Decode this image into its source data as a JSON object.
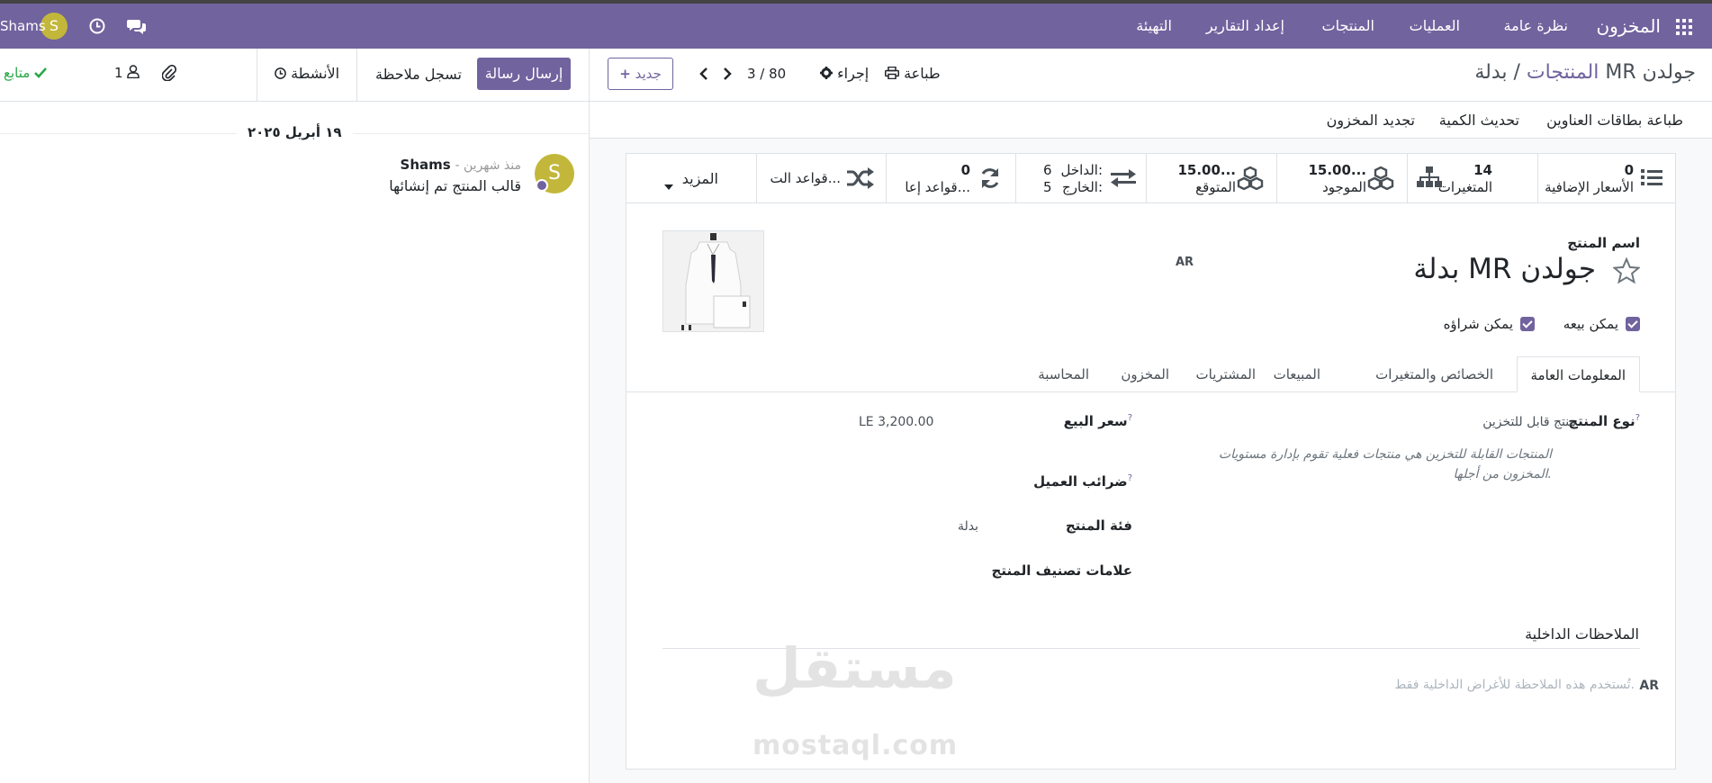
{
  "navbar": {
    "brand": "المخزون",
    "menu": [
      "نظرة عامة",
      "العمليات",
      "المنتجات",
      "إعداد التقارير",
      "التهيئة"
    ],
    "user_name": "Shams",
    "user_initial": "S"
  },
  "breadcrumb": {
    "parent": "المنتجات",
    "separator": "/",
    "current": "بدلة MR جولدن"
  },
  "toolbar": {
    "print": "طباعة",
    "action": "إجراء",
    "pager": "3 / 80",
    "new": "جديد"
  },
  "actions": [
    "طباعة بطاقات العناوين",
    "تحديث الكمية",
    "تجديد المخزون"
  ],
  "stats": {
    "extra_prices_value": "0",
    "extra_prices_label": "الأسعار الإضافية",
    "variants_value": "14",
    "variants_label": "المتغيرات",
    "on_hand_value": "15.00...",
    "on_hand_label": "الموجود",
    "forecast_value": "15.00...",
    "forecast_label": "المتوقع",
    "in_label": "الداخل:",
    "in_value": "6",
    "out_label": "الخارج:",
    "out_value": "5",
    "reorder_value": "0",
    "reorder_label": "قواعد إعا...",
    "routes_label": "قواعد الت...",
    "more_label": "المزيد"
  },
  "product": {
    "name_label": "اسم المنتج",
    "name": "بدلة MR جولدن",
    "lang": "AR",
    "can_be_sold": "يمكن بيعه",
    "can_be_purchased": "يمكن شراؤه"
  },
  "tabs": [
    "المعلومات العامة",
    "الخصائص والمتغيرات",
    "المبيعات",
    "المشتريات",
    "المخزون",
    "المحاسبة"
  ],
  "fields": {
    "product_type_label": "نوع المنتج",
    "product_type_value": "منتج قابل للتخزين",
    "product_type_help_1": "المنتجات القابلة للتخزين هي منتجات فعلية تقوم بإدارة مستويات",
    "product_type_help_2": "المخزون من أجلها.",
    "sale_price_label": "سعر البيع",
    "sale_price_value": "LE 3,200.00",
    "customer_taxes_label": "ضرائب العميل",
    "category_label": "فئة المنتج",
    "category_value": "بدلة",
    "tags_label": "علامات تصنيف المنتج",
    "tooltip_mark": "?"
  },
  "notes": {
    "title": "الملاحظات الداخلية",
    "lang": "AR",
    "placeholder": "تُستخدم هذه الملاحظة للأغراض الداخلية فقط."
  },
  "chatter": {
    "send_message": "إرسال رسالة",
    "log_note": "تسجل ملاحظة",
    "activities": "الأنشطة",
    "followers_count": "1",
    "following": "متابع",
    "date": "١٩ أبريل ٢٠٢٥",
    "author": "Shams",
    "time": "- منذ شهرين",
    "author_initial": "S",
    "message": "قالب المنتج تم إنشائها"
  },
  "watermark": {
    "arabic": "مستقل",
    "latin": "mostaql.com"
  },
  "colors": {
    "brand": "#71639e",
    "avatar": "#c2b73a",
    "following": "#28a745"
  }
}
